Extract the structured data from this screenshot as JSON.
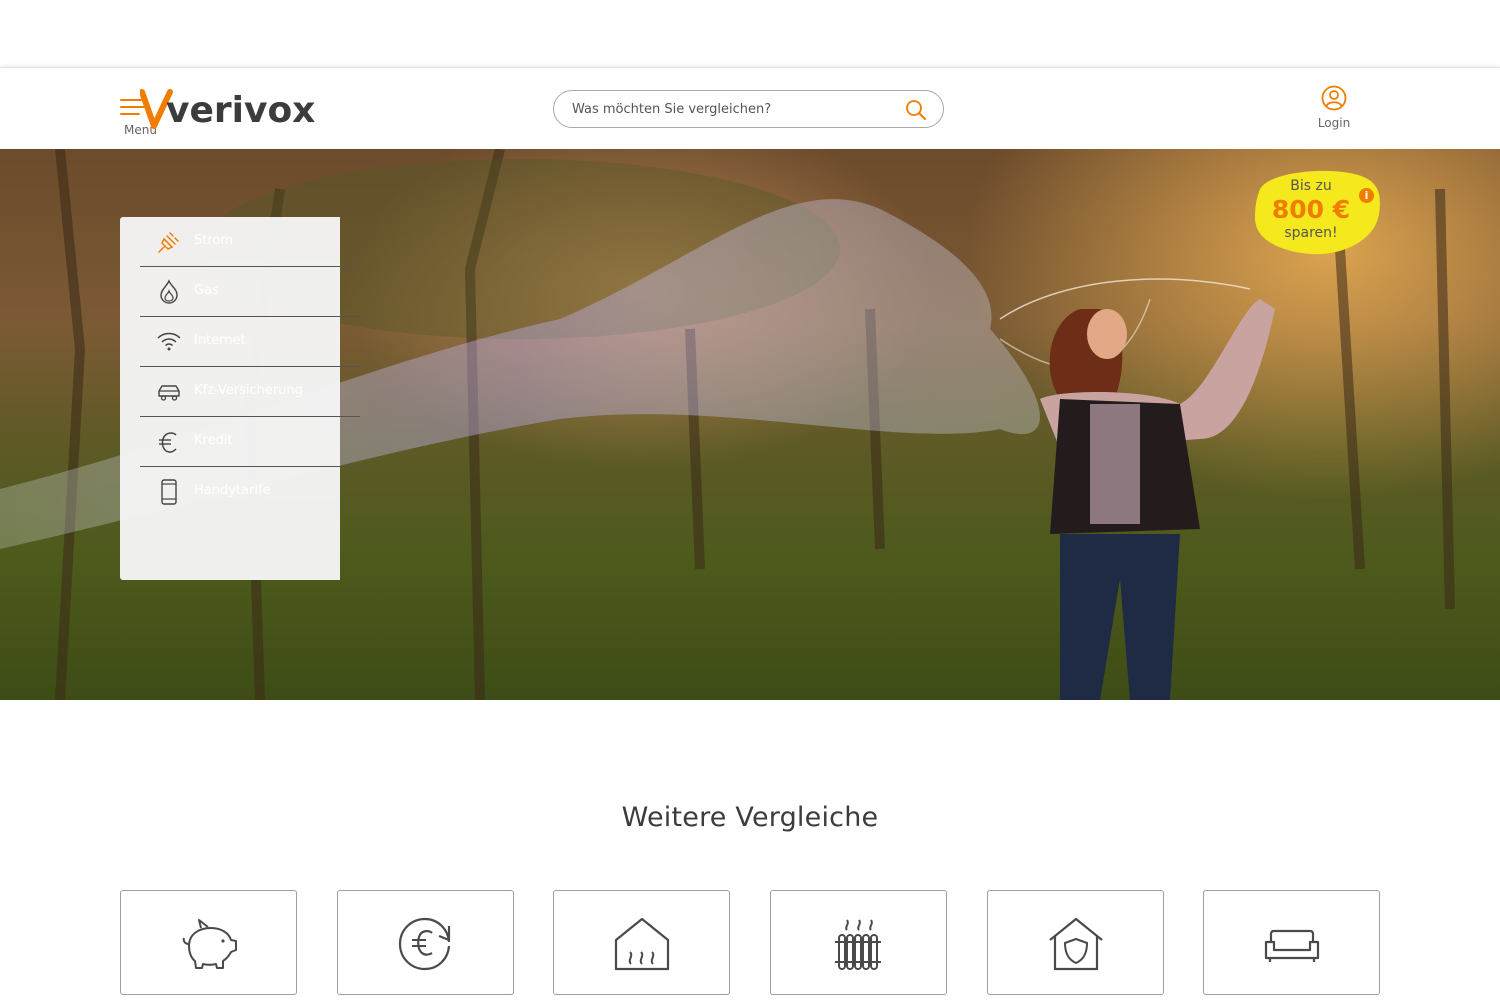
{
  "header": {
    "menu_label": "Menü",
    "brand": "verivox",
    "search_placeholder": "Was möchten Sie vergleichen?",
    "login_label": "Login",
    "accent_color": "#f07d00"
  },
  "hero": {
    "categories": [
      {
        "label": "Strom",
        "icon": "plug-icon"
      },
      {
        "label": "Gas",
        "icon": "flame-icon"
      },
      {
        "label": "Internet",
        "icon": "wifi-icon"
      },
      {
        "label": "Kfz-Versicherung",
        "icon": "car-icon"
      },
      {
        "label": "Kredit",
        "icon": "euro-icon"
      },
      {
        "label": "Handytarife",
        "icon": "smartphone-icon"
      }
    ],
    "badge": {
      "line1": "Bis zu",
      "amount": "800 €",
      "line3": "sparen!",
      "color": "#f5e81c"
    }
  },
  "more": {
    "title": "Weitere Vergleiche",
    "tiles": [
      {
        "icon": "piggy-bank-icon"
      },
      {
        "icon": "euro-refresh-icon"
      },
      {
        "icon": "house-heating-icon"
      },
      {
        "icon": "radiator-icon"
      },
      {
        "icon": "house-shield-icon"
      },
      {
        "icon": "sofa-icon"
      }
    ]
  }
}
